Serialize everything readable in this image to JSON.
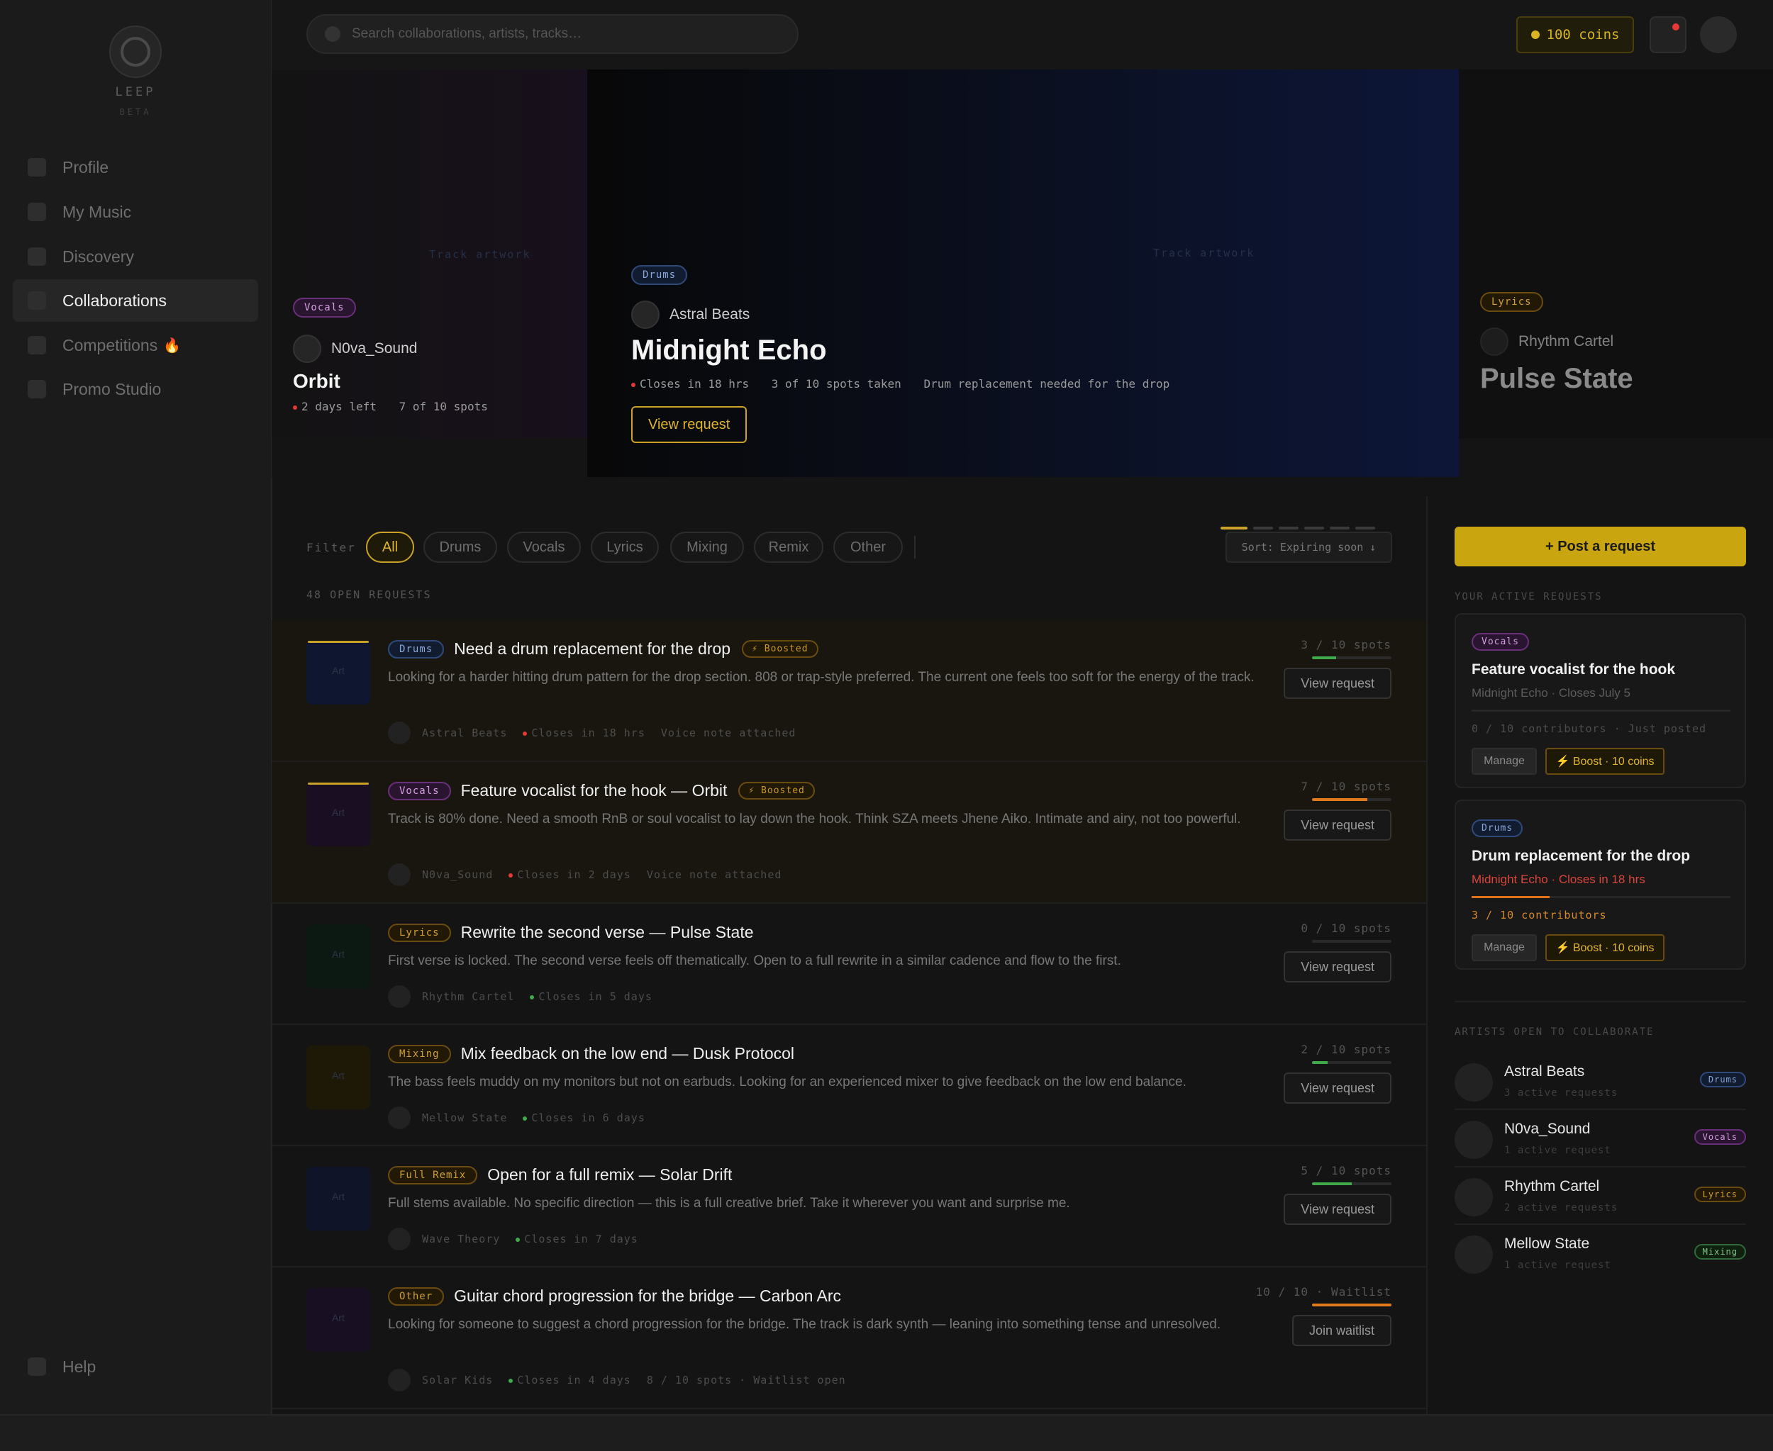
{
  "app": {
    "logo_name": "LEEP",
    "logo_tag": "BETA"
  },
  "sidebar": {
    "items": [
      {
        "label": "Profile"
      },
      {
        "label": "My Music"
      },
      {
        "label": "Discovery"
      },
      {
        "label": "Collaborations"
      },
      {
        "label": "Competitions",
        "badge": "🔥"
      },
      {
        "label": "Promo Studio"
      }
    ],
    "help_label": "Help"
  },
  "topbar": {
    "search_placeholder": "Search collaborations, artists, tracks…",
    "coins": "100 coins"
  },
  "carousel": {
    "left": {
      "tag": "Vocals",
      "artist": "N0va_Sound",
      "title": "Orbit",
      "closes": "2 days left",
      "spots": "7 of 10 spots",
      "artwork_label": "Track artwork"
    },
    "main": {
      "tag": "Drums",
      "artist": "Astral Beats",
      "title": "Midnight Echo",
      "closes": "Closes in 18 hrs",
      "spots": "3 of 10 spots taken",
      "note": "Drum replacement needed for the drop",
      "artwork_label": "Track artwork",
      "button": "View request"
    },
    "right": {
      "tag": "Lyrics",
      "artist": "Rhythm Cartel",
      "title": "Pulse State"
    },
    "active_dot": 0,
    "dot_count": 6
  },
  "filters": {
    "label": "Filter",
    "chips": [
      "All",
      "Drums",
      "Vocals",
      "Lyrics",
      "Mixing",
      "Remix",
      "Other"
    ],
    "active": "All",
    "sort_label": "Sort: Expiring soon ↓",
    "count_label": "48 OPEN REQUESTS"
  },
  "requests": [
    {
      "tag": "Drums",
      "title": "Need a drum replacement for the drop",
      "boosted": "⚡ Boosted",
      "desc": "Looking for a harder hitting drum pattern for the drop section. 808 or trap-style preferred. The current one feels too soft for the energy of the track.",
      "artist": "Astral Beats",
      "closes": "Closes in 18 hrs",
      "extra": "Voice note attached",
      "spots": "3 / 10 spots",
      "fill": 0.3,
      "fill_color": "#3fa94b",
      "button": "View request",
      "art": "Art",
      "art_color": "#0f1730"
    },
    {
      "tag": "Vocals",
      "title": "Feature vocalist for the hook — Orbit",
      "boosted": "⚡ Boosted",
      "desc": "Track is 80% done. Need a smooth RnB or soul vocalist to lay down the hook. Think SZA meets Jhene Aiko. Intimate and airy, not too powerful.",
      "artist": "N0va_Sound",
      "closes": "Closes in 2 days",
      "extra": "Voice note attached",
      "spots": "7 / 10 spots",
      "fill": 0.7,
      "fill_color": "#e07a1a",
      "button": "View request",
      "art": "Art",
      "art_color": "#1a0f22"
    },
    {
      "tag": "Lyrics",
      "title": "Rewrite the second verse — Pulse State",
      "boosted": "",
      "desc": "First verse is locked. The second verse feels off thematically. Open to a full rewrite in a similar cadence and flow to the first.",
      "artist": "Rhythm Cartel",
      "closes": "Closes in 5 days",
      "extra": "",
      "spots": "0 / 10 spots",
      "fill": 0,
      "fill_color": "#3fa94b",
      "button": "View request",
      "art": "Art",
      "art_color": "#0c1812"
    },
    {
      "tag": "Mixing",
      "title": "Mix feedback on the low end — Dusk Protocol",
      "boosted": "",
      "desc": "The bass feels muddy on my monitors but not on earbuds. Looking for an experienced mixer to give feedback on the low end balance.",
      "artist": "Mellow State",
      "closes": "Closes in 6 days",
      "extra": "",
      "spots": "2 / 10 spots",
      "fill": 0.2,
      "fill_color": "#3fa94b",
      "button": "View request",
      "art": "Art",
      "art_color": "#1e1806"
    },
    {
      "tag": "Full Remix",
      "title": "Open for a full remix — Solar Drift",
      "boosted": "",
      "desc": "Full stems available. No specific direction — this is a full creative brief. Take it wherever you want and surprise me.",
      "artist": "Wave Theory",
      "closes": "Closes in 7 days",
      "extra": "",
      "spots": "5 / 10 spots",
      "fill": 0.5,
      "fill_color": "#3fa94b",
      "button": "View request",
      "art": "Art",
      "art_color": "#0f1428"
    },
    {
      "tag": "Other",
      "title": "Guitar chord progression for the bridge — Carbon Arc",
      "boosted": "",
      "desc": "Looking for someone to suggest a chord progression for the bridge. The track is dark synth — leaning into something tense and unresolved.",
      "artist": "Solar Kids",
      "closes": "Closes in 4 days",
      "extra": "8 / 10 spots · Waitlist open",
      "spots": "10 / 10 · Waitlist",
      "fill": 1,
      "fill_color": "#e07a1a",
      "button": "Join waitlist",
      "art": "Art",
      "art_color": "#180f22"
    }
  ],
  "right_panel": {
    "post_button": "+ Post a request",
    "active_label": "YOUR ACTIVE REQUESTS",
    "active_requests": [
      {
        "tag": "Vocals",
        "title": "Feature vocalist for the hook",
        "sub": "Midnight Echo · Closes July 5",
        "contrib": "0 / 10 contributors · Just posted",
        "manage": "Manage",
        "boost": "⚡ Boost · 10 coins"
      },
      {
        "tag": "Drums",
        "title": "Drum replacement for the drop",
        "sub": "Midnight Echo · Closes in 18 hrs",
        "contrib": "3 / 10 contributors",
        "manage": "Manage",
        "boost": "⚡ Boost · 10 coins"
      }
    ],
    "artists_label": "ARTISTS OPEN TO COLLABORATE",
    "artists": [
      {
        "name": "Astral Beats",
        "active": "3 active requests",
        "tag": "Drums"
      },
      {
        "name": "N0va_Sound",
        "active": "1 active request",
        "tag": "Vocals"
      },
      {
        "name": "Rhythm Cartel",
        "active": "2 active requests",
        "tag": "Lyrics"
      },
      {
        "name": "Mellow State",
        "active": "1 active request",
        "tag": "Mixing"
      }
    ]
  }
}
